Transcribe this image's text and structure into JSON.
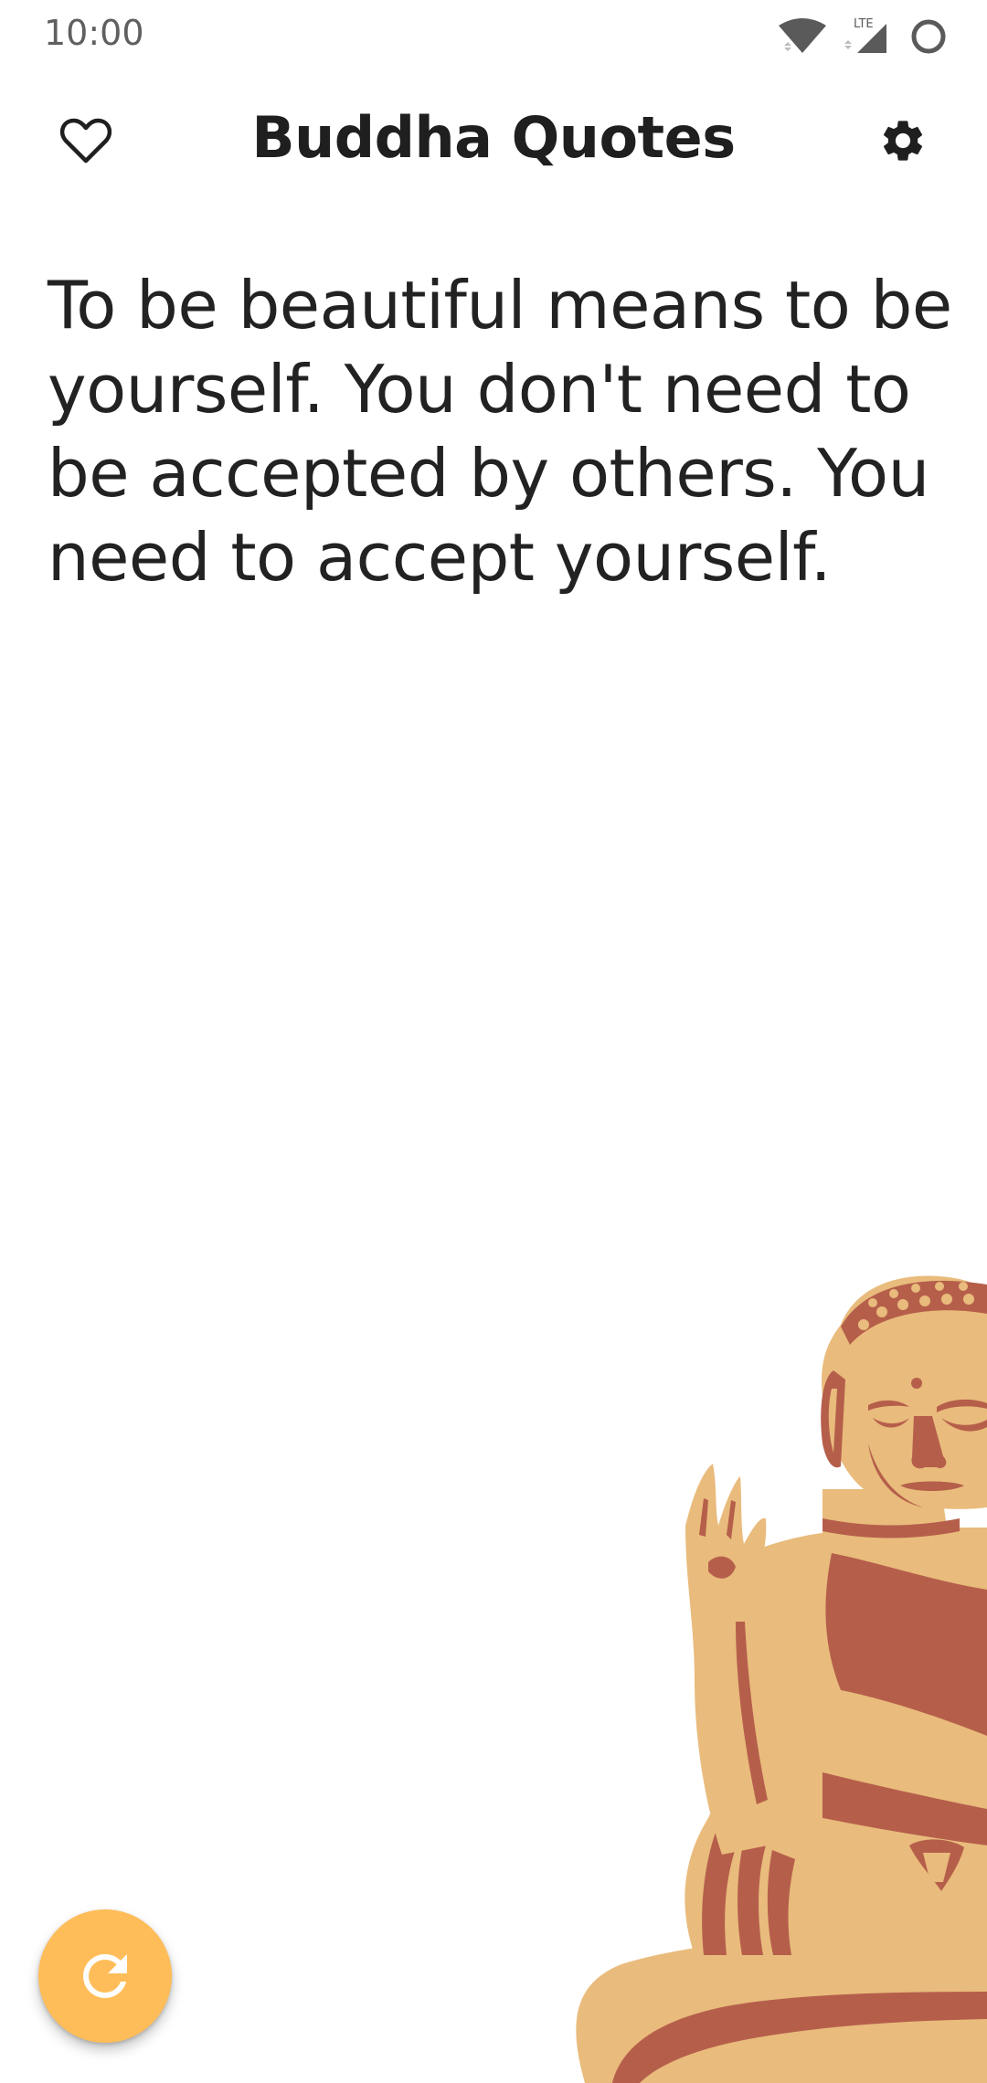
{
  "status_bar": {
    "time": "10:00",
    "network_label": "LTE",
    "icons": [
      "wifi-icon",
      "lte-signal-icon",
      "battery-circle-icon"
    ]
  },
  "toolbar": {
    "title": "Buddha Quotes",
    "favorite_icon": "heart-outline-icon",
    "settings_icon": "gear-icon"
  },
  "quote": {
    "text": "To be beautiful means to be yourself. You don't need to be accepted by others. You need to accept yourself."
  },
  "fab": {
    "icon": "refresh-icon"
  },
  "colors": {
    "fab": "#ffbd59",
    "buddha_light": "#e9bb7c",
    "buddha_dark": "#b55f4b",
    "text": "#222222"
  }
}
